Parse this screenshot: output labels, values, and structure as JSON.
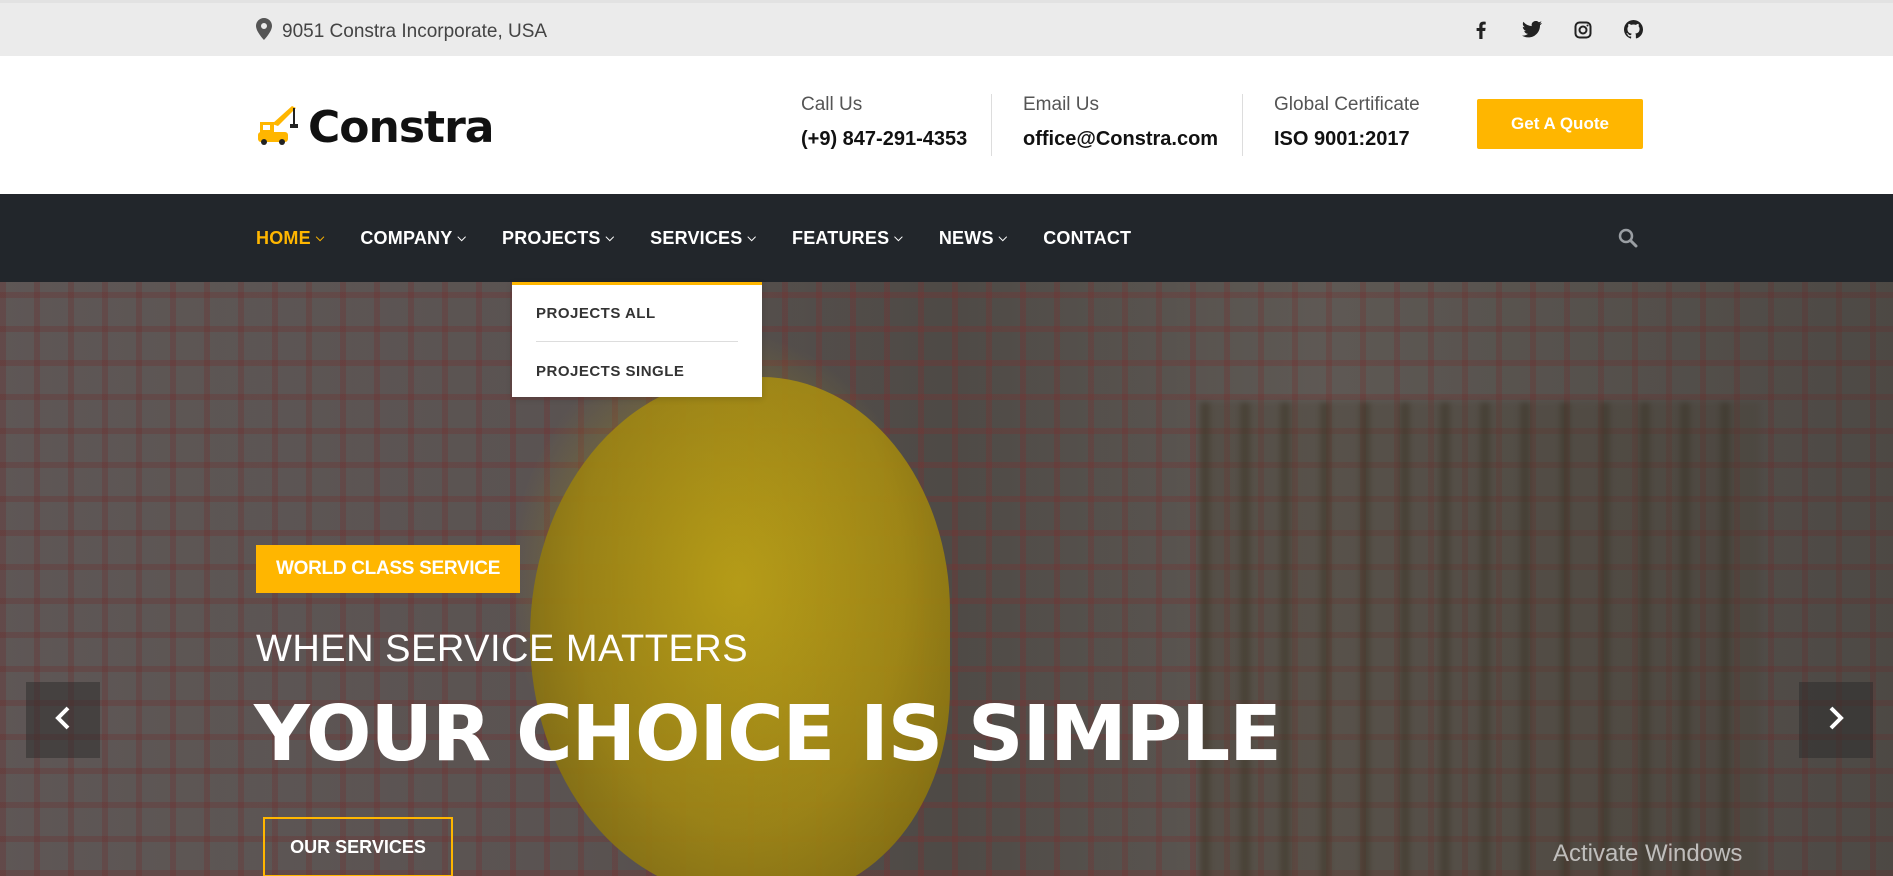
{
  "topbar": {
    "address": "9051 Constra Incorporate, USA",
    "social_icons": [
      "facebook-icon",
      "twitter-icon",
      "instagram-icon",
      "github-icon"
    ]
  },
  "header": {
    "logo_text": "Constra",
    "call": {
      "label": "Call Us",
      "value": "(+9) 847-291-4353"
    },
    "email": {
      "label": "Email Us",
      "value": "office@Constra.com"
    },
    "certificate": {
      "label": "Global Certificate",
      "value": "ISO 9001:2017"
    },
    "quote_button": "Get A Quote"
  },
  "nav": {
    "items": [
      {
        "label": "HOME",
        "active": true
      },
      {
        "label": "COMPANY"
      },
      {
        "label": "PROJECTS"
      },
      {
        "label": "SERVICES"
      },
      {
        "label": "FEATURES"
      },
      {
        "label": "NEWS"
      },
      {
        "label": "CONTACT"
      }
    ],
    "dropdown": [
      "PROJECTS ALL",
      "PROJECTS SINGLE"
    ]
  },
  "hero": {
    "tag": "WORLD CLASS SERVICE",
    "subtitle": "WHEN SERVICE MATTERS",
    "title": "YOUR CHOICE IS SIMPLE",
    "button": "OUR SERVICES"
  },
  "system": {
    "watermark": "Activate Windows"
  },
  "colors": {
    "accent": "#ffb600",
    "nav_bg": "#22262b",
    "topbar_bg": "#ebebeb"
  }
}
